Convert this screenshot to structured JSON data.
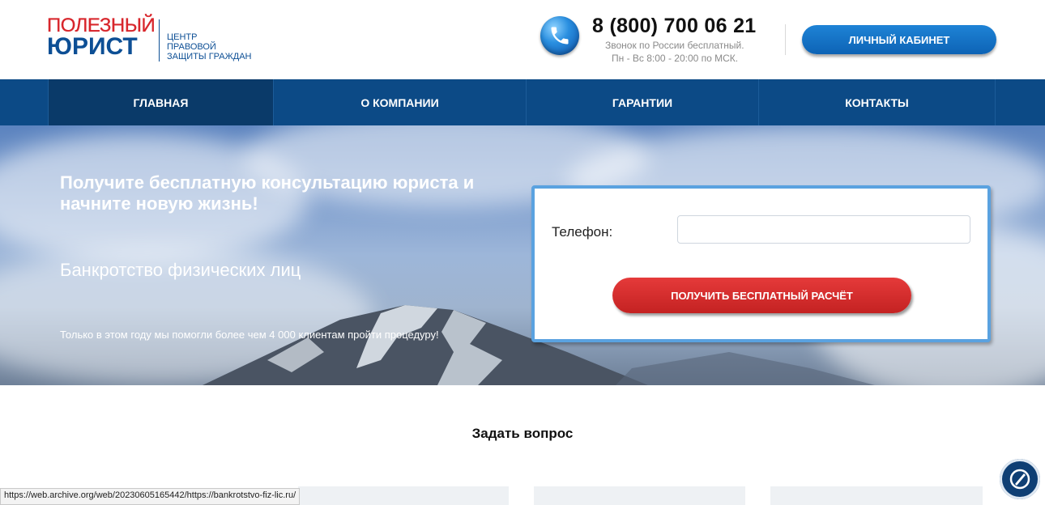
{
  "header": {
    "logo_top": "ПОЛЕЗНЫЙ",
    "logo_bottom": "ЮРИСТ",
    "logo_tagline": [
      "ЦЕНТР",
      "ПРАВОВОЙ",
      "ЗАЩИТЫ ГРАЖДАН"
    ],
    "phone": "8 (800) 700 06 21",
    "phone_note_1": "Звонок по России бесплатный.",
    "phone_note_2": "Пн - Вс 8:00 - 20:00 по МСК.",
    "phone_icon": "phone-icon",
    "cabinet_label": "Личный кабинет"
  },
  "nav": {
    "items": [
      {
        "label": "Главная",
        "active": true
      },
      {
        "label": "О компании",
        "active": false
      },
      {
        "label": "Гарантии",
        "active": false
      },
      {
        "label": "Контакты",
        "active": false
      }
    ]
  },
  "hero": {
    "title": "Получите бесплатную консультацию юриста и начните новую жизнь!",
    "subtitle": "Банкротство физических лиц",
    "note": "Только в этом году мы помогли более чем 4 000 клиентам пройти процедуру!",
    "form": {
      "phone_label": "Телефон:",
      "phone_value": "",
      "submit_label": "Получить бесплатный расчёт"
    }
  },
  "section": {
    "title": "Задать вопрос"
  },
  "status_bar": {
    "url": "https://web.archive.org/web/20230605165442/https://bankrotstvo-fiz-lic.ru/"
  },
  "colors": {
    "brand_blue": "#0d4f95",
    "brand_red": "#d8262c",
    "nav_bg": "#0c4a86",
    "submit_red": "#d32f2f"
  }
}
